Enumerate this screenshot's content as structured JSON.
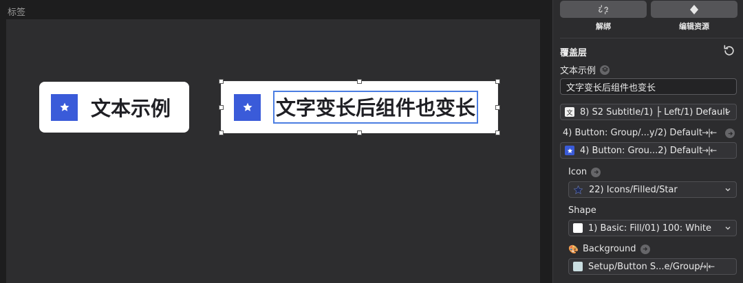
{
  "canvas": {
    "page_label": "标签",
    "chip1_text": "文本示例",
    "chip2_text": "文字变长后组件也变长",
    "accent": "#3a5bd9",
    "selection_color": "#4a7de2"
  },
  "panel": {
    "btn_unlink_label": "解绑",
    "btn_edit_label": "编辑资源",
    "section_title": "覆盖层",
    "text_label": "文本示例",
    "text_value": "文字变长后组件也变长",
    "text_style": "8) S2 Subtitle/1) ├ Left/1) Default",
    "text_style_badge": "文",
    "button_label": "4) Button: Group/...y/2) Default",
    "button_select": "4) Button: Grou...2) Default",
    "arrows": "→|←",
    "icon_label": "Icon",
    "icon_select": "22) Icons/Filled/Star",
    "shape_label": "Shape",
    "shape_select": "1) Basic: Fill/01) 100: White",
    "background_label": "Background",
    "background_emoji": "🎨",
    "background_select": "Setup/Button S...e/Group/"
  }
}
